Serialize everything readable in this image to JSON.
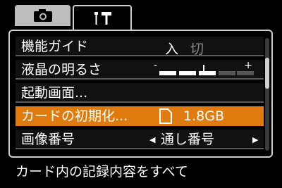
{
  "tabs": [
    {
      "icon": "camera-icon"
    },
    {
      "icon": "tools-icon"
    }
  ],
  "menu": {
    "rows": [
      {
        "label": "機能ガイド",
        "value_on": "入",
        "value_off": "切"
      },
      {
        "label": "液晶の明るさ",
        "minus": "-",
        "plus": "+",
        "level": 3,
        "max_level": 5
      },
      {
        "label": "起動画面..."
      },
      {
        "label": "カードの初期化...",
        "value": "1.8GB"
      },
      {
        "label": "画像番号",
        "value": "通し番号"
      }
    ],
    "selected_index": 3
  },
  "help_text": "カード内の記録内容をすべて",
  "colors": {
    "highlight": "#e07b0f",
    "frame": "#cfcfcf"
  }
}
